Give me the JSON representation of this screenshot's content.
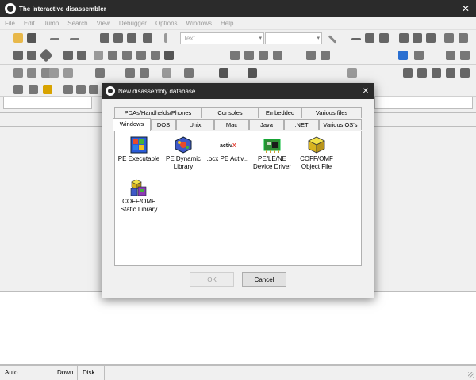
{
  "window": {
    "title": "The interactive disassembler"
  },
  "menubar": {
    "items": [
      "File",
      "Edit",
      "Jump",
      "Search",
      "View",
      "Debugger",
      "Options",
      "Windows",
      "Help"
    ]
  },
  "toolbar": {
    "text_select": "Text"
  },
  "statusbar": {
    "mode": "Auto",
    "direction": "Down",
    "disk": "Disk"
  },
  "dialog": {
    "title": "New disassembly database",
    "tabs_top": [
      "PDAs/Handhelds/Phones",
      "Consoles",
      "Embedded",
      "Various files"
    ],
    "tabs_bottom": [
      "Windows",
      "DOS",
      "Unix",
      "Mac",
      "Java",
      ".NET",
      "Various OS's"
    ],
    "active_tab": "Windows",
    "items": [
      {
        "label": "PE Executable",
        "icon": "pe-executable-icon"
      },
      {
        "label": "PE Dynamic Library",
        "icon": "pe-dll-icon"
      },
      {
        "label": ".ocx PE Activ...",
        "icon": "activex-icon"
      },
      {
        "label": "PE/LE/NE Device Driver",
        "icon": "device-driver-icon"
      },
      {
        "label": "COFF/OMF Object File",
        "icon": "object-file-icon"
      },
      {
        "label": "COFF/OMF Static Library",
        "icon": "static-library-icon"
      }
    ],
    "ok_label": "OK",
    "cancel_label": "Cancel"
  },
  "colors": {
    "titlebar": "#2b2b2b",
    "background": "#f0f0f0",
    "panel": "#ffffff"
  }
}
